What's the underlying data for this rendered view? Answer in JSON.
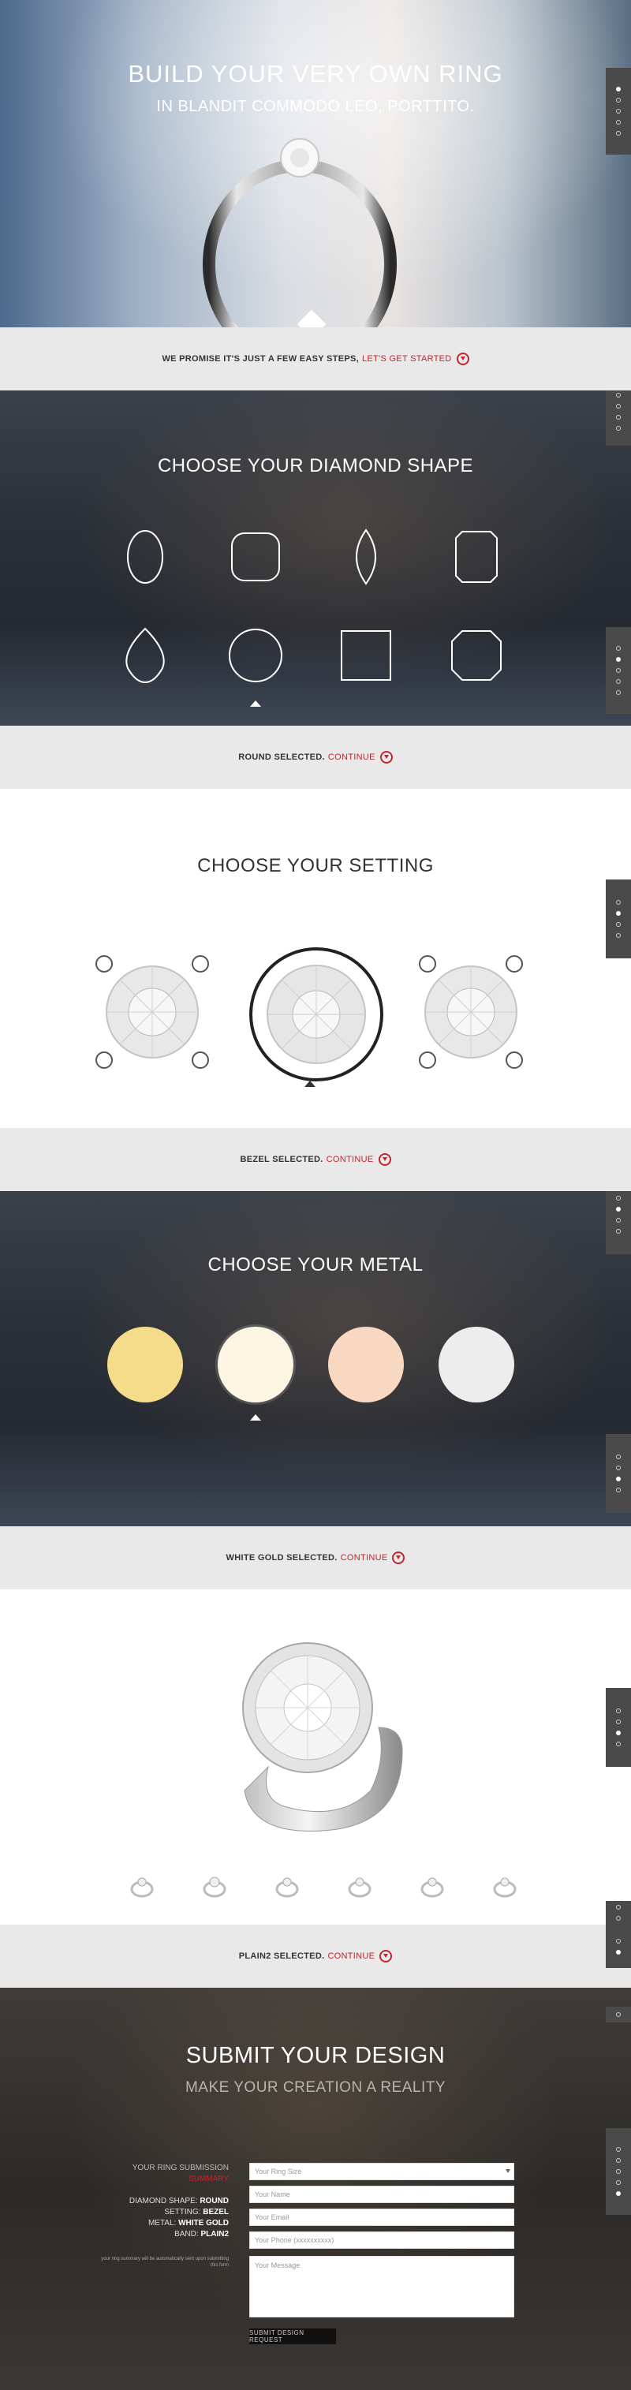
{
  "hero": {
    "title": "BUILD YOUR VERY OWN RING",
    "subtitle": "IN BLANDIT COMMODO LEO, PORTTITO."
  },
  "strip1": {
    "text": "WE PROMISE IT'S JUST A FEW EASY STEPS,",
    "link": "LET'S GET STARTED"
  },
  "shape": {
    "title": "CHOOSE YOUR DIAMOND SHAPE",
    "options": [
      "oval",
      "cushion",
      "marquise",
      "emerald",
      "pear",
      "round",
      "princess",
      "asscher"
    ],
    "selected": "round"
  },
  "strip2": {
    "text": "ROUND SELECTED.",
    "link": "CONTINUE"
  },
  "setting": {
    "title": "CHOOSE YOUR SETTING",
    "options": [
      "prong",
      "bezel",
      "halo"
    ],
    "selected": "bezel"
  },
  "strip3": {
    "text": "BEZEL SELECTED.",
    "link": "CONTINUE"
  },
  "metal": {
    "title": "CHOOSE YOUR METAL",
    "colors": [
      "#f5dc8a",
      "#fbf5e2",
      "#f8d8c1",
      "#ededed"
    ],
    "selected_index": 1
  },
  "strip4": {
    "text": "WHITE GOLD SELECTED.",
    "link": "CONTINUE"
  },
  "band": {
    "thumb_count": 6
  },
  "strip5": {
    "text": "PLAIN2 SELECTED.",
    "link": "CONTINUE"
  },
  "submit": {
    "title": "SUBMIT YOUR DESIGN",
    "subtitle": "MAKE YOUR CREATION A REALITY",
    "summary_label": "YOUR RING SUBMISSION",
    "summary_sub": "SUMMARY",
    "shape_label": "DIAMOND SHAPE:",
    "shape_value": "ROUND",
    "setting_label": "SETTING:",
    "setting_value": "BEZEL",
    "metal_label": "METAL:",
    "metal_value": "WHITE GOLD",
    "band_label": "BAND:",
    "band_value": "PLAIN2",
    "note": "your ring summary will be automatically sent upon submitting this form",
    "ring_size_placeholder": "Your Ring Size",
    "name_placeholder": "Your Name",
    "email_placeholder": "Your Email",
    "phone_placeholder": "Your Phone (xxxxxxxxxx)",
    "message_placeholder": "Your Message",
    "button": "SUBMIT DESIGN REQUEST"
  },
  "colors": {
    "accent": "#c0262d"
  }
}
